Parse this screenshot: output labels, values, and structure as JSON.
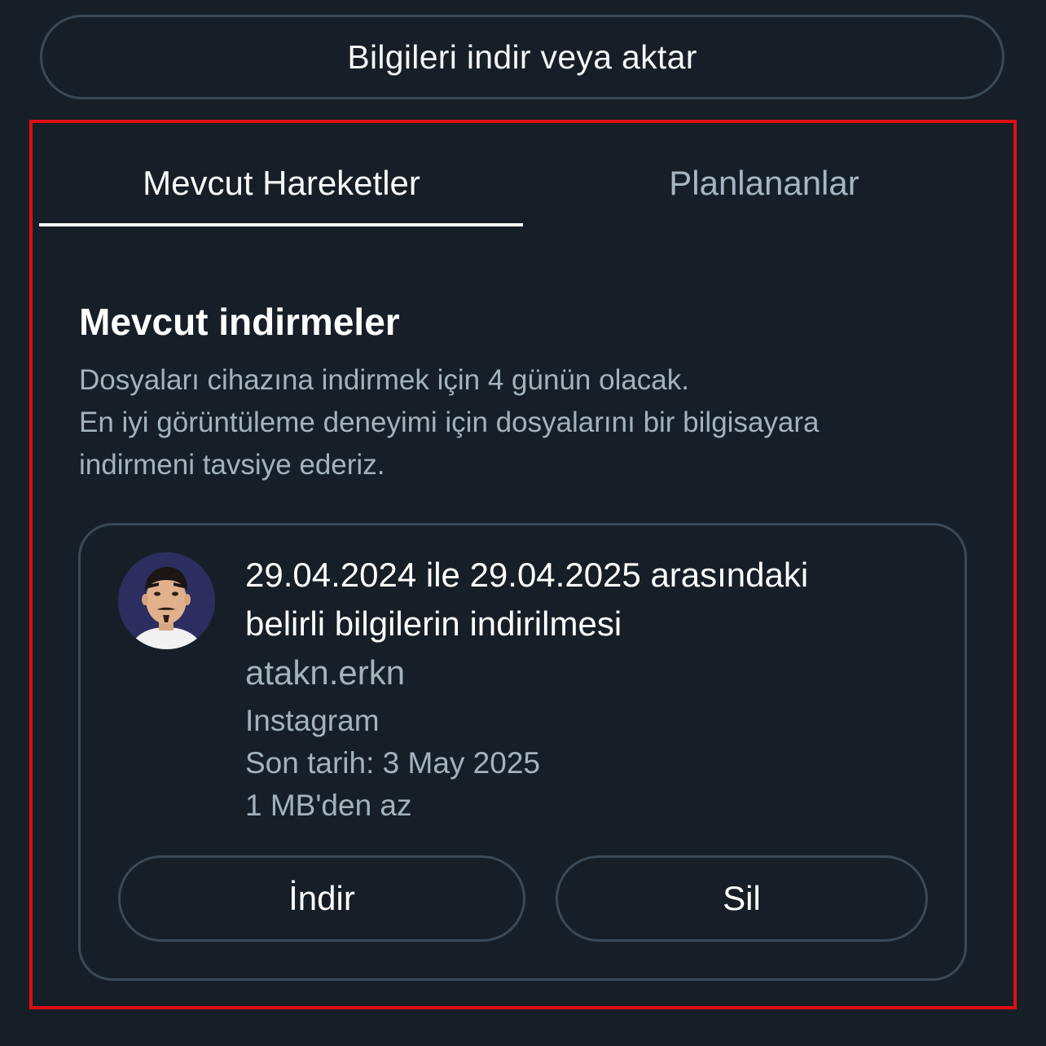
{
  "top_button": {
    "label": "Bilgileri indir veya aktar"
  },
  "tabs": [
    {
      "label": "Mevcut Hareketler",
      "active": true
    },
    {
      "label": "Planlananlar",
      "active": false
    }
  ],
  "section": {
    "title": "Mevcut indirmeler",
    "description_lines": [
      "Dosyaları cihazına indirmek için 4 günün olacak.",
      "En iyi görüntüleme deneyimi için dosyalarını bir bilgisayara",
      "indirmeni tavsiye ederiz."
    ]
  },
  "download_card": {
    "title_lines": [
      "29.04.2024 ile 29.04.2025 arasındaki",
      "belirli bilgilerin indirilmesi"
    ],
    "username": "atakn.erkn",
    "platform": "Instagram",
    "deadline": "Son tarih: 3 May 2025",
    "size": "1 MB'den az",
    "download_label": "İndir",
    "delete_label": "Sil"
  },
  "colors": {
    "background": "#161f27",
    "border": "#3b4956",
    "muted_text": "#a4b2be",
    "highlight": "#e00d14"
  }
}
